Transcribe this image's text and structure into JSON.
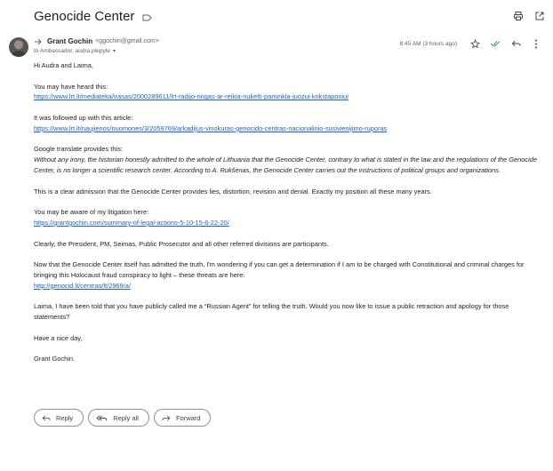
{
  "email": {
    "subject": "Genocide Center",
    "sender_name": "Grant Gochin",
    "sender_email": "<ggochin@gmail.com>",
    "recipients": "to Ambassador, audra.plepyte",
    "time": "8:45 AM (3 hours ago)"
  },
  "body": {
    "greeting": "Hi Audra and Laima,",
    "p1": "You may have heard this:",
    "link1": "https://www.lrt.lt/mediateka/irasas/2000289611/lrt-radijo-ringas-ar-reikia-nukelti-paminkla-juozui-krikstaponiui",
    "p2": "It was followed up with this article:",
    "link2": "https://www.lrt.lt/naujienos/nuomones/3/2059769/arkadijus-vinokuras-genocido-centras-nacionalinio-susivienijimo-ruporas",
    "p3": "Google translate provides this:",
    "quote": "Without any irony, the historian honestly admitted to the whole of Lithuania that the Genocide Center, contrary to what is stated in the law and the regulations of the Genocide Center, is no longer a scientific research center. According to A. Rukšėnas, the Genocide Center carries out the instructions of political groups and organizations.",
    "p4": "This is a clear admission that the Genocide Center provides lies, distortion, revision and denial. Exactly my position all these many years.",
    "p5": "You may be aware of my litigation here:",
    "link3": "https://grantgochin.com/summary-of-legal-actions-5-10-15-6-22-20/",
    "p6": "Clearly, the President, PM, Seimas, Public Prosecutor and all other referred divisions are participants.",
    "p7": "Now that the Genocide Center itself has admitted the truth, I'm wondering if you can get a determination if I am to be charged with Constitutional and criminal charges for bringing this Holocaust fraud conspiracy to light – these threats are here:",
    "link4": "http://genocid.lt/centras/lt/2969/a/",
    "p8": "Laima, I have been told that you have publicly called me a “Russian Agent” for telling the truth. Would you now like to issue a public retraction and apology for those statements?",
    "p9": "Have a nice day,",
    "signature": "Grant Gochin."
  },
  "actions": {
    "reply": "Reply",
    "reply_all": "Reply all",
    "forward": "Forward"
  },
  "icons": {
    "label": "label-outline-icon",
    "print": "print-icon",
    "open_new": "open-in-new-window-icon",
    "star": "star-outline-icon",
    "check": "double-check-icon",
    "reply": "reply-icon",
    "more": "more-vert-icon"
  },
  "colors": {
    "link": "#1a62c5",
    "check": "#34a853"
  }
}
